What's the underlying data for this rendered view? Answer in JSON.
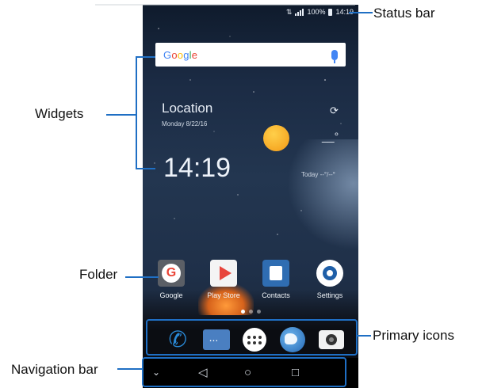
{
  "callouts": {
    "status_bar": "Status bar",
    "widgets": "Widgets",
    "folder": "Folder",
    "primary_icons": "Primary icons",
    "navigation_bar": "Navigation bar"
  },
  "status_bar": {
    "battery": "100%",
    "time": "14:19"
  },
  "search": {
    "brand": "Google",
    "icon": "mic-icon"
  },
  "widget": {
    "location": "Location",
    "date": "Monday 8/22/16",
    "temperature": "__°",
    "clock": "14:19",
    "forecast": "Today  --°/--°",
    "weather_icon": "sun-icon",
    "refresh_icon": "refresh-icon"
  },
  "apps": [
    {
      "label": "Google",
      "icon": "google-folder-icon"
    },
    {
      "label": "Play Store",
      "icon": "play-store-icon"
    },
    {
      "label": "Contacts",
      "icon": "contacts-icon"
    },
    {
      "label": "Settings",
      "icon": "settings-icon"
    }
  ],
  "dock": [
    "phone-icon",
    "messaging-icon",
    "app-drawer-icon",
    "browser-icon",
    "camera-icon"
  ],
  "navigation": [
    "hide-chevron-icon",
    "back-icon",
    "home-icon",
    "recents-icon"
  ],
  "colors": {
    "callout_line": "#1f6fc4",
    "accent_blue": "#4285f4"
  }
}
